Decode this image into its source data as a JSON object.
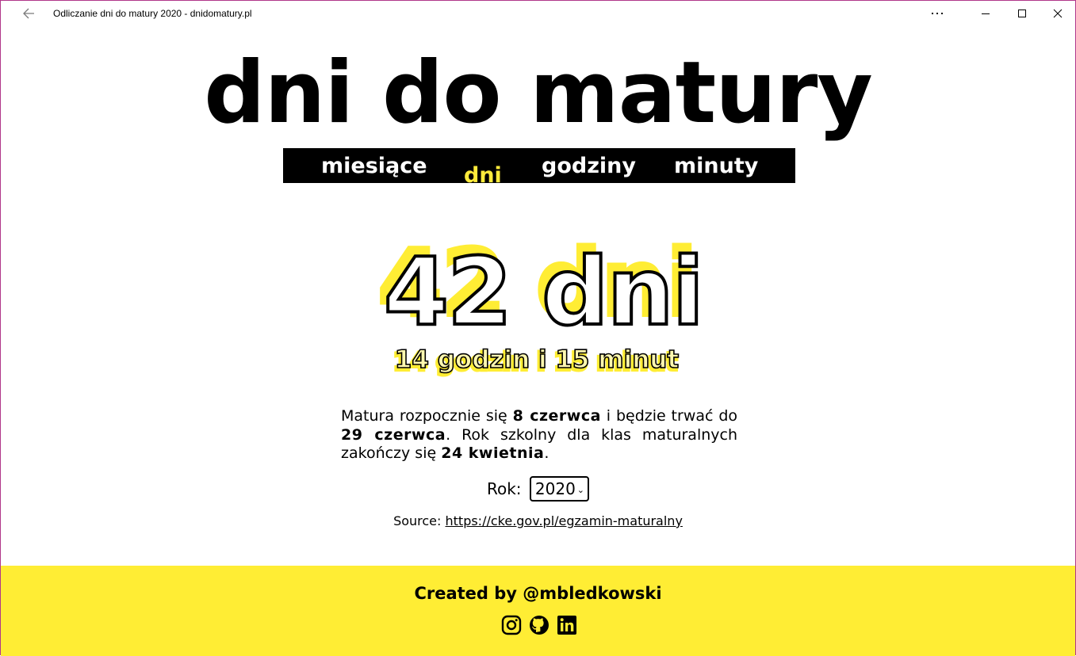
{
  "window": {
    "title": "Odliczanie dni do matury 2020 - dnidomatury.pl"
  },
  "header": {
    "headline": "dni do matury"
  },
  "tabs": [
    {
      "label": "miesiące"
    },
    {
      "label": "dni",
      "active": true
    },
    {
      "label": "godziny"
    },
    {
      "label": "minuty"
    }
  ],
  "countdown": {
    "main": "42 dni",
    "sub": "14 godzin i 15 minut"
  },
  "info": {
    "p1": "Matura rozpocznie się ",
    "start_date": "8 czerwca",
    "p2": " i będzie trwać do ",
    "end_date": "29 czerwca",
    "p3": ". Rok szkolny dla klas maturalnych zakończy się ",
    "school_end_date": "24 kwietnia",
    "p4": "."
  },
  "year": {
    "label": "Rok:",
    "selected": "2020"
  },
  "source": {
    "label": "Source: ",
    "link": "https://cke.gov.pl/egzamin-maturalny"
  },
  "footer": {
    "credit": "Created by @mbledkowski",
    "icons": [
      "instagram-icon",
      "github-icon",
      "linkedin-icon"
    ]
  },
  "colors": {
    "accent": "#ffed34",
    "text": "#000000"
  }
}
